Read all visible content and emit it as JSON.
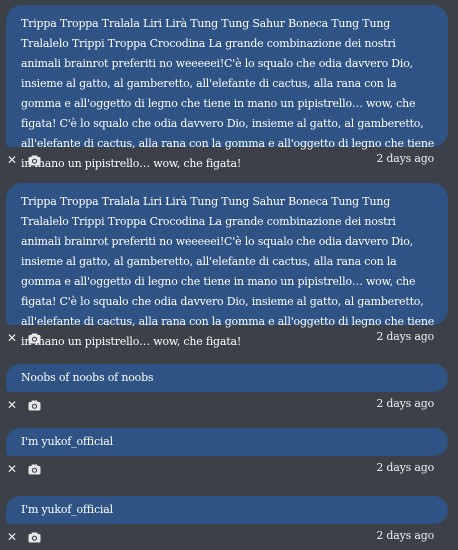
{
  "messages": [
    {
      "text": "Trippa Troppa Tralala Liri Lirà Tung Tung Sahur Boneca Tung Tung Tralalelo Trippi Troppa Crocodina La grande combinazione dei nostri animali brainrot preferiti no weeeeei!C'è lo squalo che odia davvero Dio, insieme al gatto, al gamberetto, all'elefante di cactus, alla rana con la gomma e all'oggetto di legno che tiene in mano un pipistrello… wow, che figata! C'è lo squalo che odia davvero Dio, insieme al gatto, al gamberetto, all'elefante di cactus, alla rana con la gomma e all'oggetto di legno che tiene in mano un pipistrello… wow, che figata!",
      "time": "2 days ago"
    },
    {
      "text": "Trippa Troppa Tralala Liri Lirà Tung Tung Sahur Boneca Tung Tung Tralalelo Trippi Troppa Crocodina La grande combinazione dei nostri animali brainrot preferiti no weeeeei!C'è lo squalo che odia davvero Dio, insieme al gatto, al gamberetto, all'elefante di cactus, alla rana con la gomma e all'oggetto di legno che tiene in mano un pipistrello… wow, che figata! C'è lo squalo che odia davvero Dio, insieme al gatto, al gamberetto, all'elefante di cactus, alla rana con la gomma e all'oggetto di legno che tiene in mano un pipistrello… wow, che figata!",
      "time": "2 days ago"
    },
    {
      "text": "Noobs of noobs of noobs",
      "time": "2 days ago"
    },
    {
      "text": "I'm yukof_official",
      "time": "2 days ago"
    },
    {
      "text": "I'm yukof_official",
      "time": "2 days ago"
    }
  ],
  "icons": {
    "close": "close-icon",
    "camera": "camera-icon"
  },
  "colors": {
    "background": "#3c4048",
    "bubble": "#2e5384",
    "text": "#ffffff"
  }
}
